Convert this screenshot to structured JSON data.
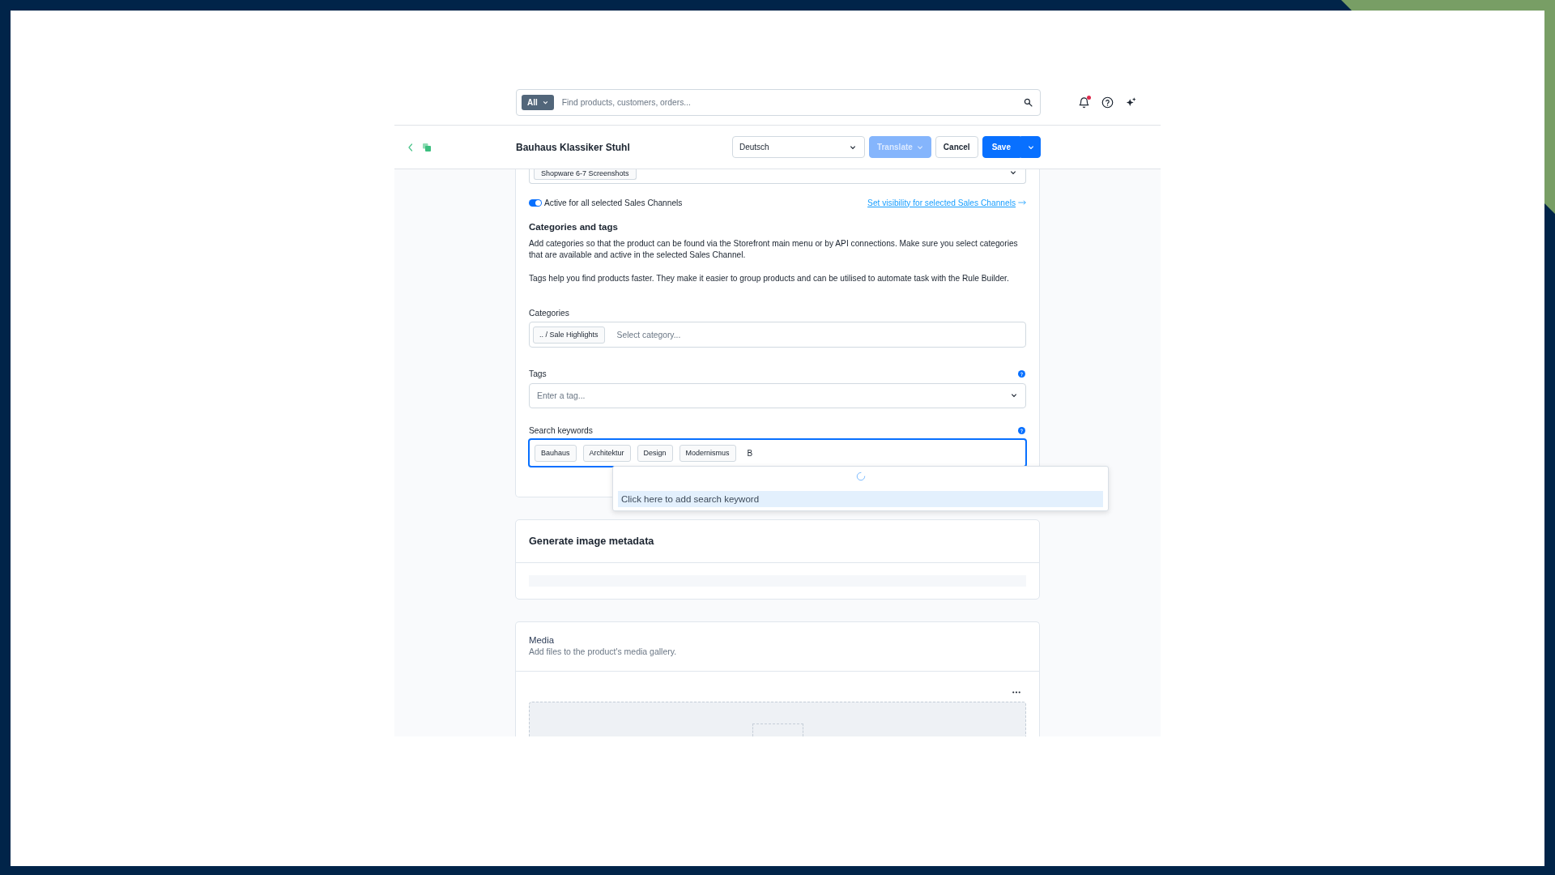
{
  "top_bar": {
    "search": {
      "scope": "All",
      "placeholder": "Find products, customers, orders..."
    },
    "notifications": {
      "unread": true
    }
  },
  "header": {
    "title": "Bauhaus Klassiker Stuhl",
    "language": "Deutsch",
    "buttons": [
      {
        "label": "Translate",
        "kind": "dropdown",
        "primary": true,
        "disabled": true
      },
      {
        "label": "Cancel",
        "kind": "plain",
        "primary": false,
        "disabled": false
      },
      {
        "label": "Save",
        "kind": "split",
        "primary": true,
        "disabled": false
      }
    ]
  },
  "product_card": {
    "sales_channels": {
      "chips": [
        "Shopware 6-7 Screenshots"
      ]
    },
    "active_toggle": {
      "label": "Active for all selected Sales Channels",
      "on": true
    },
    "visibility_link": "Set visibility for selected Sales Channels",
    "section_title": "Categories and tags",
    "paragraphs": [
      "Add categories so that the product can be found via the Storefront main menu or by API connections. Make sure you select categories that are available and active in the selected Sales Channel.",
      "Tags help you find products faster. They make it easier to group products and can be utilised to automate task with the Rule Builder."
    ],
    "categories": {
      "label": "Categories",
      "chips": [
        ".. / Sale Highlights"
      ],
      "placeholder": "Select category...",
      "focused": false
    },
    "tags": {
      "label": "Tags",
      "placeholder": "Enter a tag...",
      "focused": false
    },
    "search_keywords": {
      "label": "Search keywords",
      "chips": [
        "Bauhaus",
        "Architektur",
        "Design",
        "Modernismus"
      ],
      "value": "B",
      "focused": true,
      "suggestions": {
        "loading": true,
        "items": [
          {
            "label": "Click here to add search keyword",
            "selected": true
          }
        ]
      }
    }
  },
  "image_metadata_card": {
    "title": "Generate image metadata",
    "loading": true
  },
  "media_card": {
    "title": "Media",
    "subtitle": "Add files to the product's media gallery."
  }
}
